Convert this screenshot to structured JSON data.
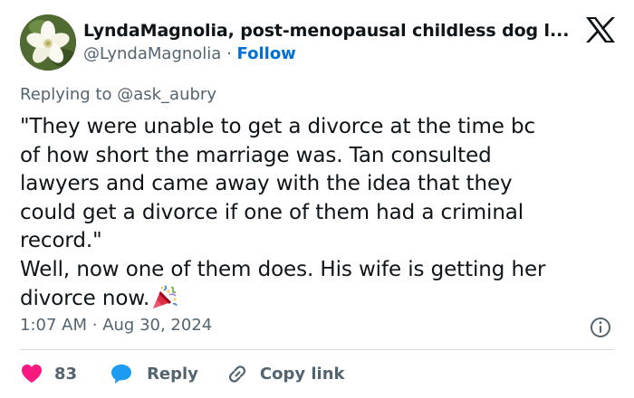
{
  "author": {
    "display_name": "LyndaMagnolia, post-menopausal childless dog l...",
    "handle": "@LyndaMagnolia",
    "separator": "·",
    "follow_label": "Follow"
  },
  "reply_context": {
    "prefix": "Replying to",
    "mention": "@ask_aubry"
  },
  "tweet": {
    "text": "\"They were unable to get a divorce at the time bc\nof how short the marriage was. Tan consulted\nlawyers and came away with the idea that they\ncould get a divorce if one of them had a criminal\nrecord.\"\nWell, now one of them does. His wife is getting her\ndivorce now.",
    "emoji": "party-popper-icon"
  },
  "meta": {
    "time": "1:07 AM",
    "separator": "·",
    "date": "Aug 30, 2024"
  },
  "actions": {
    "like_count": "83",
    "reply_label": "Reply",
    "copy_link_label": "Copy link"
  },
  "colors": {
    "text": "#0f1419",
    "secondary": "#536471",
    "follow": "#006fd6",
    "like": "#f91880",
    "reply": "#1d9bf0",
    "divider": "#cfd9de"
  },
  "icons": {
    "brand": "x-logo-icon",
    "info": "info-icon",
    "like": "heart-icon",
    "reply": "speech-bubble-icon",
    "copy": "link-icon"
  }
}
